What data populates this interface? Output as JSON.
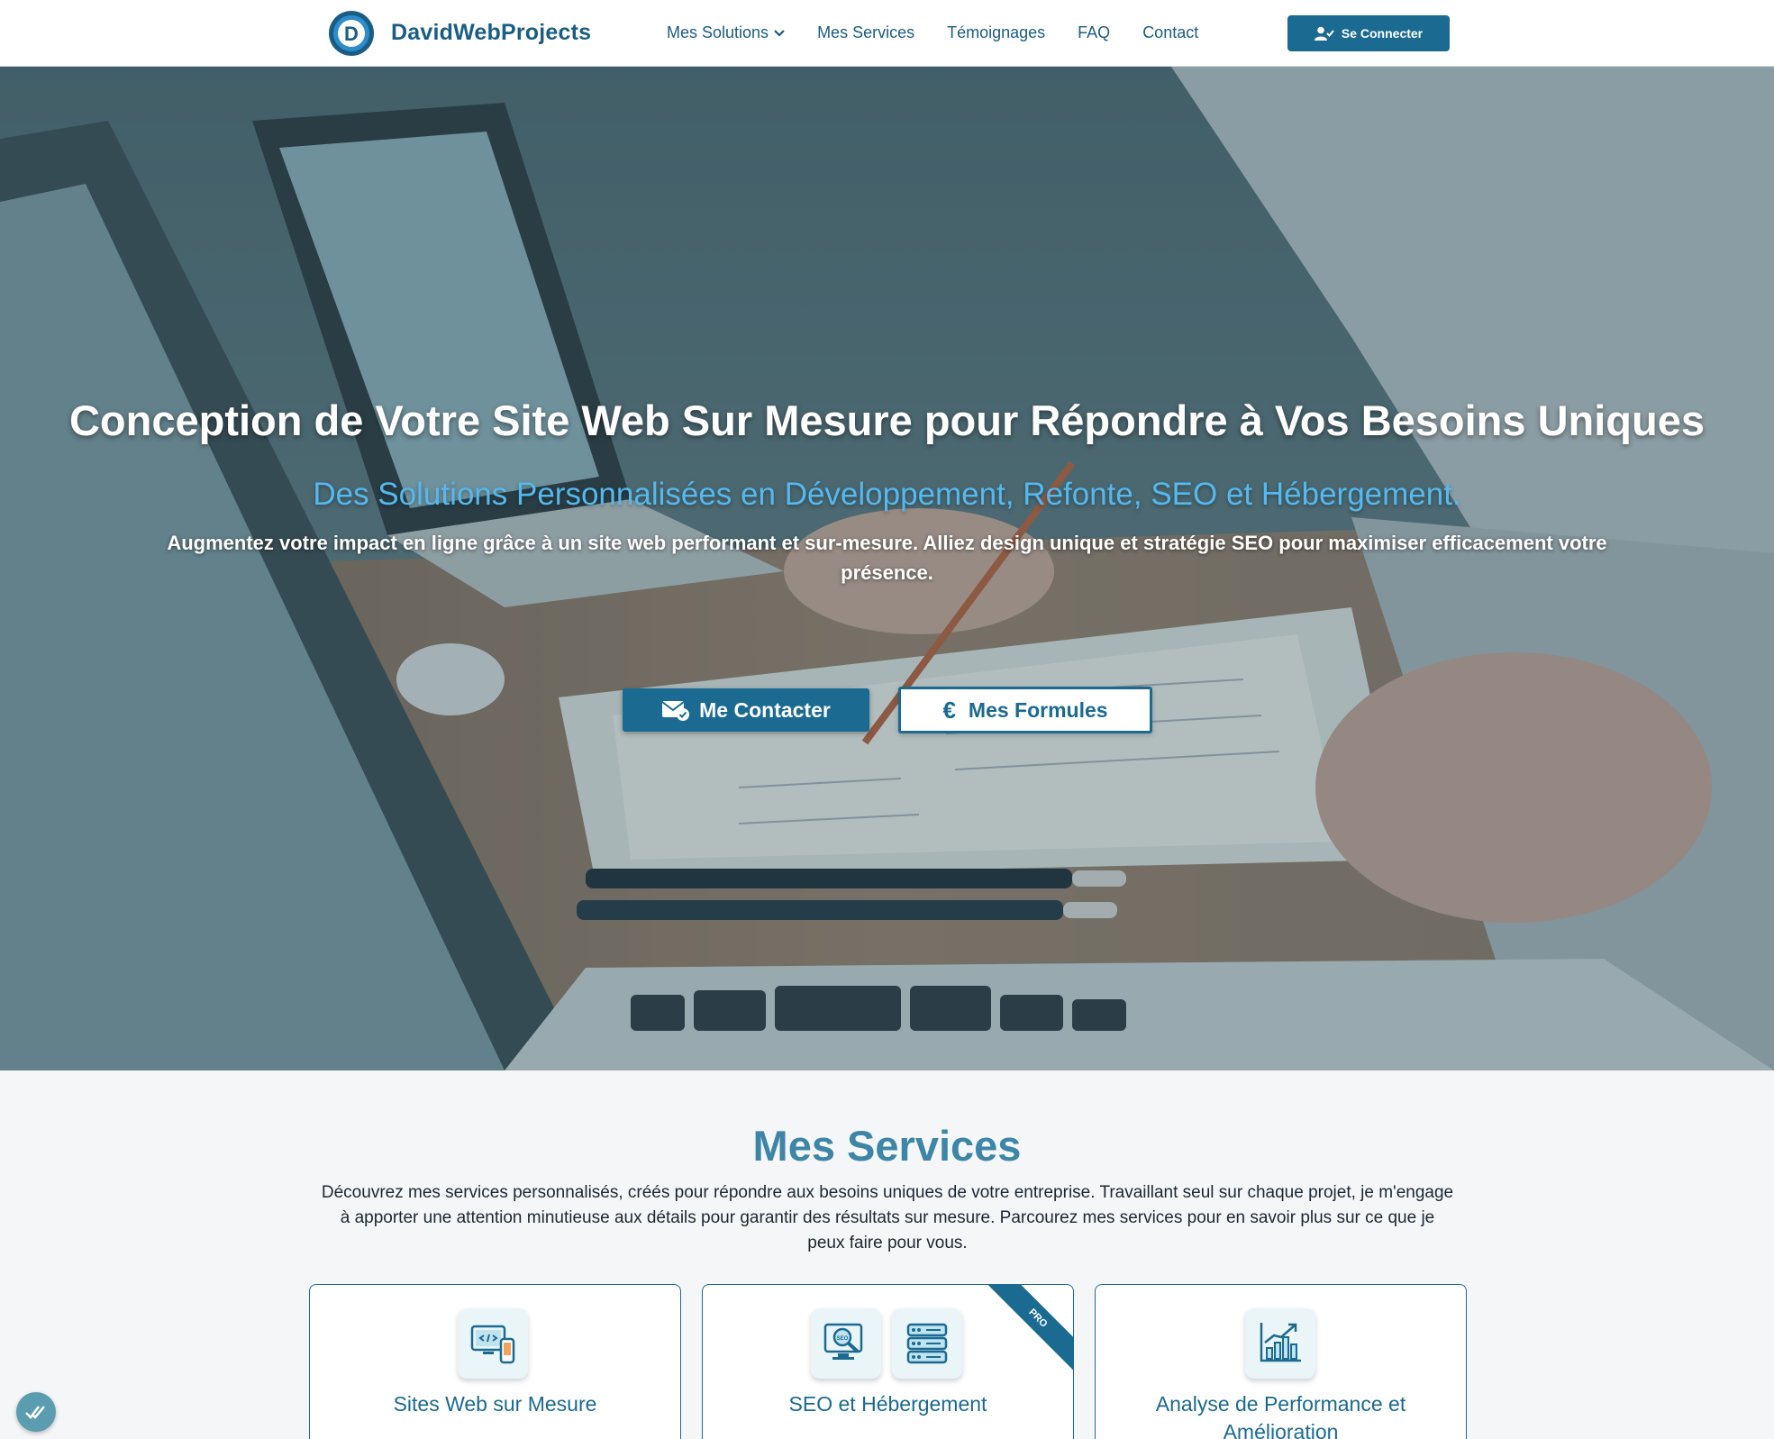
{
  "header": {
    "brand": "DavidWebProjects",
    "nav": [
      {
        "label": "Mes Solutions",
        "has_dropdown": true
      },
      {
        "label": "Mes Services"
      },
      {
        "label": "Témoignages"
      },
      {
        "label": "FAQ"
      },
      {
        "label": "Contact"
      }
    ],
    "login_label": "Se Connecter"
  },
  "hero": {
    "title": "Conception de Votre Site Web Sur Mesure pour Répondre à Vos Besoins Uniques",
    "subtitle": "Des Solutions Personnalisées en Développement, Refonte, SEO et Hébergement.",
    "description": "Augmentez votre impact en ligne grâce à un site web performant et sur-mesure. Alliez design unique et stratégie SEO pour maximiser efficacement votre présence.",
    "contact_button": "Me Contacter",
    "formulas_button": "Mes Formules",
    "currency_symbol": "€"
  },
  "services": {
    "title": "Mes Services",
    "description": "Découvrez mes services personnalisés, créés pour répondre aux besoins uniques de votre entreprise. Travaillant seul sur chaque projet, je m'engage à apporter une attention minutieuse aux détails pour garantir des résultats sur mesure. Parcourez mes services pour en savoir plus sur ce que je peux faire pour vous.",
    "cards": [
      {
        "title": "Sites Web sur Mesure",
        "icon": "web-dev-icon"
      },
      {
        "title": "SEO et Hébergement",
        "icon": "seo-icon",
        "icon2": "server-icon",
        "ribbon": "PRO"
      },
      {
        "title": "Analyse de Performance et Amélioration",
        "icon": "growth-chart-icon"
      }
    ]
  },
  "colors": {
    "primary": "#1a6a92",
    "accent": "#55b8ee",
    "section_title": "#3d86a8"
  }
}
